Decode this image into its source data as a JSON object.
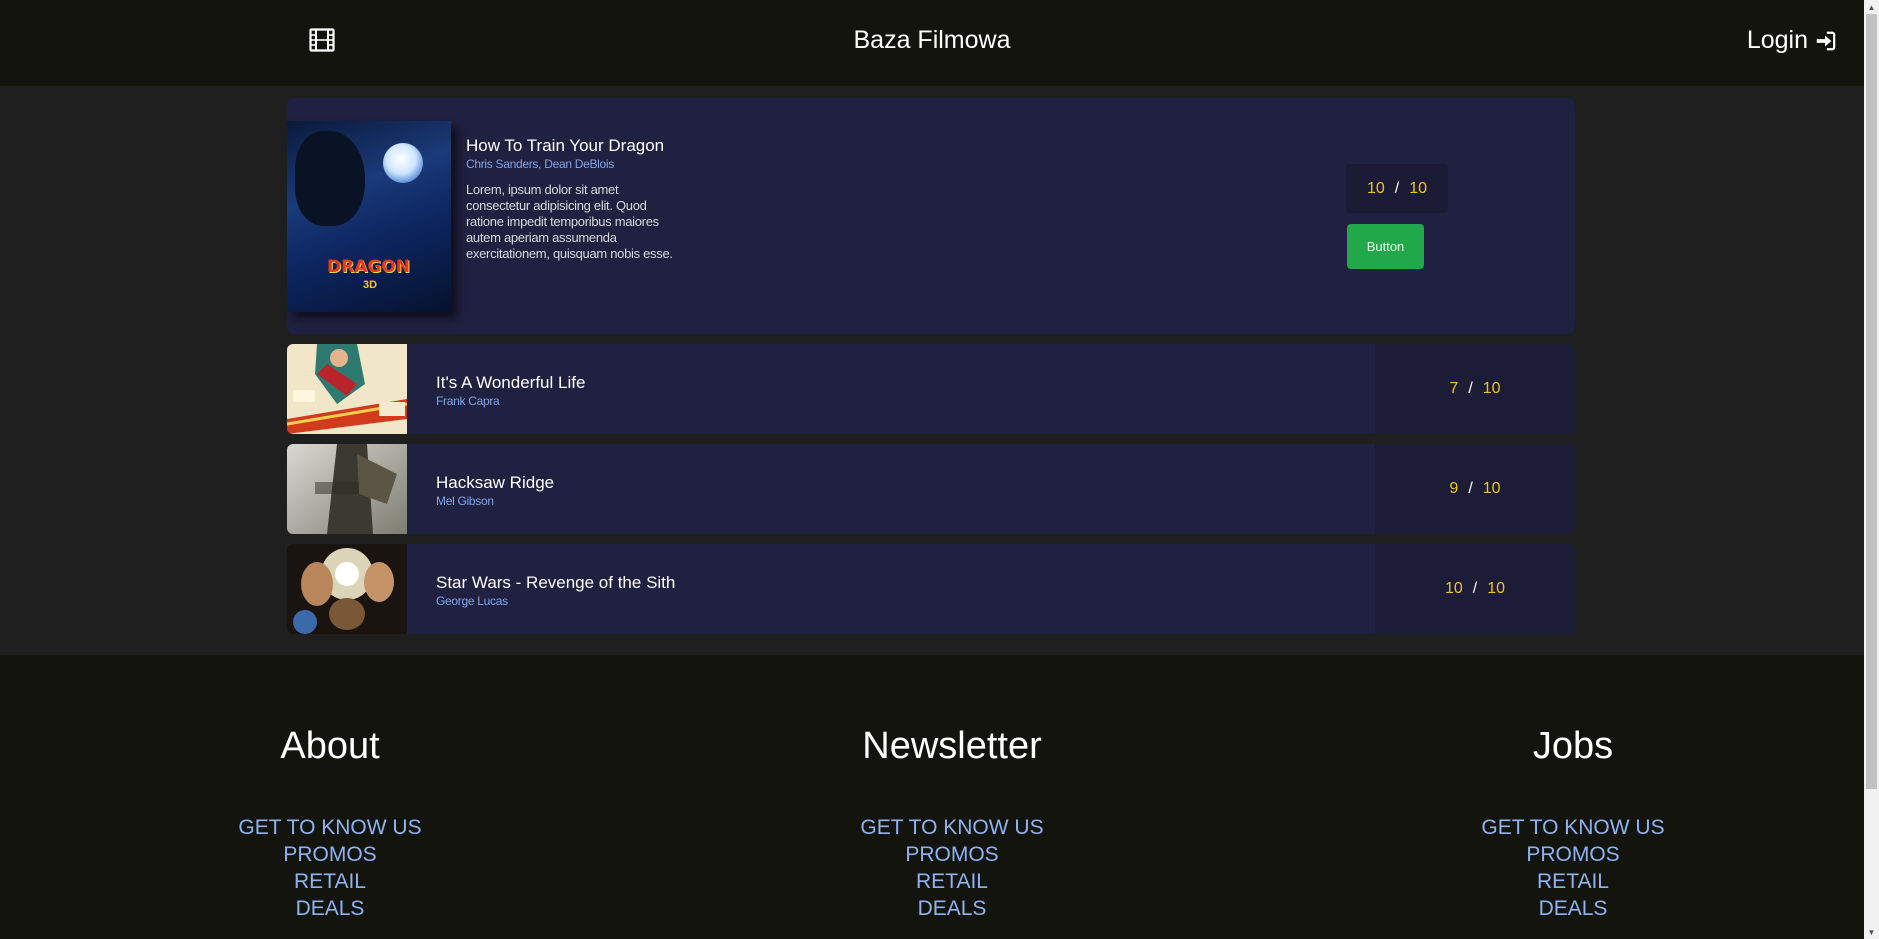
{
  "header": {
    "title": "Baza Filmowa",
    "login_label": "Login",
    "logo_icon": "film-icon",
    "login_icon": "sign-in-icon"
  },
  "featured": {
    "title": "How To Train Your Dragon",
    "director": "Chris Sanders, Dean DeBlois",
    "description": "Lorem, ipsum dolor sit amet consectetur adipisicing elit. Quod ratione impedit temporibus maiores autem aperiam assumenda exercitationem, quisquam nobis esse.",
    "rating": "10",
    "rating_max": "10",
    "slash": "/",
    "button_label": "Button",
    "poster_text": "DRAGON",
    "poster_sub": "3D"
  },
  "movies": [
    {
      "title": "It's A Wonderful Life",
      "director": "Frank Capra",
      "rating": "7",
      "rating_max": "10",
      "slash": "/"
    },
    {
      "title": "Hacksaw Ridge",
      "director": "Mel Gibson",
      "rating": "9",
      "rating_max": "10",
      "slash": "/"
    },
    {
      "title": "Star Wars - Revenge of the Sith",
      "director": "George Lucas",
      "rating": "10",
      "rating_max": "10",
      "slash": "/"
    }
  ],
  "footer": {
    "columns": [
      {
        "heading": "About",
        "links": [
          "GET TO KNOW US",
          "PROMOS",
          "RETAIL",
          "DEALS"
        ]
      },
      {
        "heading": "Newsletter",
        "links": [
          "GET TO KNOW US",
          "PROMOS",
          "RETAIL",
          "DEALS"
        ]
      },
      {
        "heading": "Jobs",
        "links": [
          "GET TO KNOW US",
          "PROMOS",
          "RETAIL",
          "DEALS"
        ]
      }
    ]
  },
  "colors": {
    "rating": "#f0c419",
    "button": "#21a84a",
    "link": "#8fb3f0",
    "card": "#202040"
  }
}
